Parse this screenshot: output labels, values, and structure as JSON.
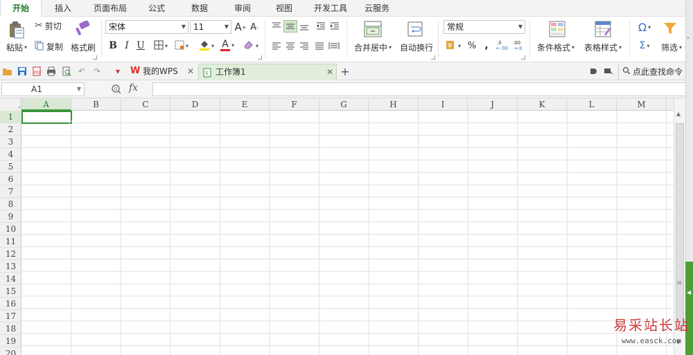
{
  "menu_tabs": [
    "开始",
    "插入",
    "页面布局",
    "公式",
    "数据",
    "审阅",
    "视图",
    "开发工具",
    "云服务"
  ],
  "ribbon": {
    "paste_label": "粘贴",
    "cut_label": "剪切",
    "copy_label": "复制",
    "format_painter_label": "格式刷",
    "font_name": "宋体",
    "font_size": "11",
    "bold": "B",
    "italic": "I",
    "underline": "U",
    "font_color_glyph": "A",
    "merge_center_label": "合并居中",
    "wrap_text_label": "自动换行",
    "number_format": "常规",
    "percent_glyph": "%",
    "comma_glyph": ",",
    "conditional_format_label": "条件格式",
    "table_style_label": "表格样式",
    "filter_label": "筛选",
    "sum_glyph": "Σ",
    "symbol_glyph": "Ω"
  },
  "quickbar": {
    "my_wps_tab": "我的WPS",
    "workbook_tab": "工作簿1",
    "find_command": "点此查找命令"
  },
  "formula_bar": {
    "cell_ref": "A1",
    "fx_label": "fx",
    "formula_value": ""
  },
  "grid": {
    "columns": [
      "A",
      "B",
      "C",
      "D",
      "E",
      "F",
      "G",
      "H",
      "I",
      "J",
      "K",
      "L",
      "M"
    ],
    "rows": [
      "1",
      "2",
      "3",
      "4",
      "5",
      "6",
      "7",
      "8",
      "9",
      "10",
      "11",
      "12",
      "13",
      "14",
      "15",
      "16",
      "17",
      "18",
      "19",
      "20"
    ],
    "selected_cell": "A1"
  },
  "watermark": {
    "title": "易采站长站",
    "url": "www.easck.com"
  },
  "colors": {
    "accent_green": "#3a8f3a",
    "active_tab_text": "#2b7a2b",
    "watermark_red": "#cf3a3a"
  }
}
